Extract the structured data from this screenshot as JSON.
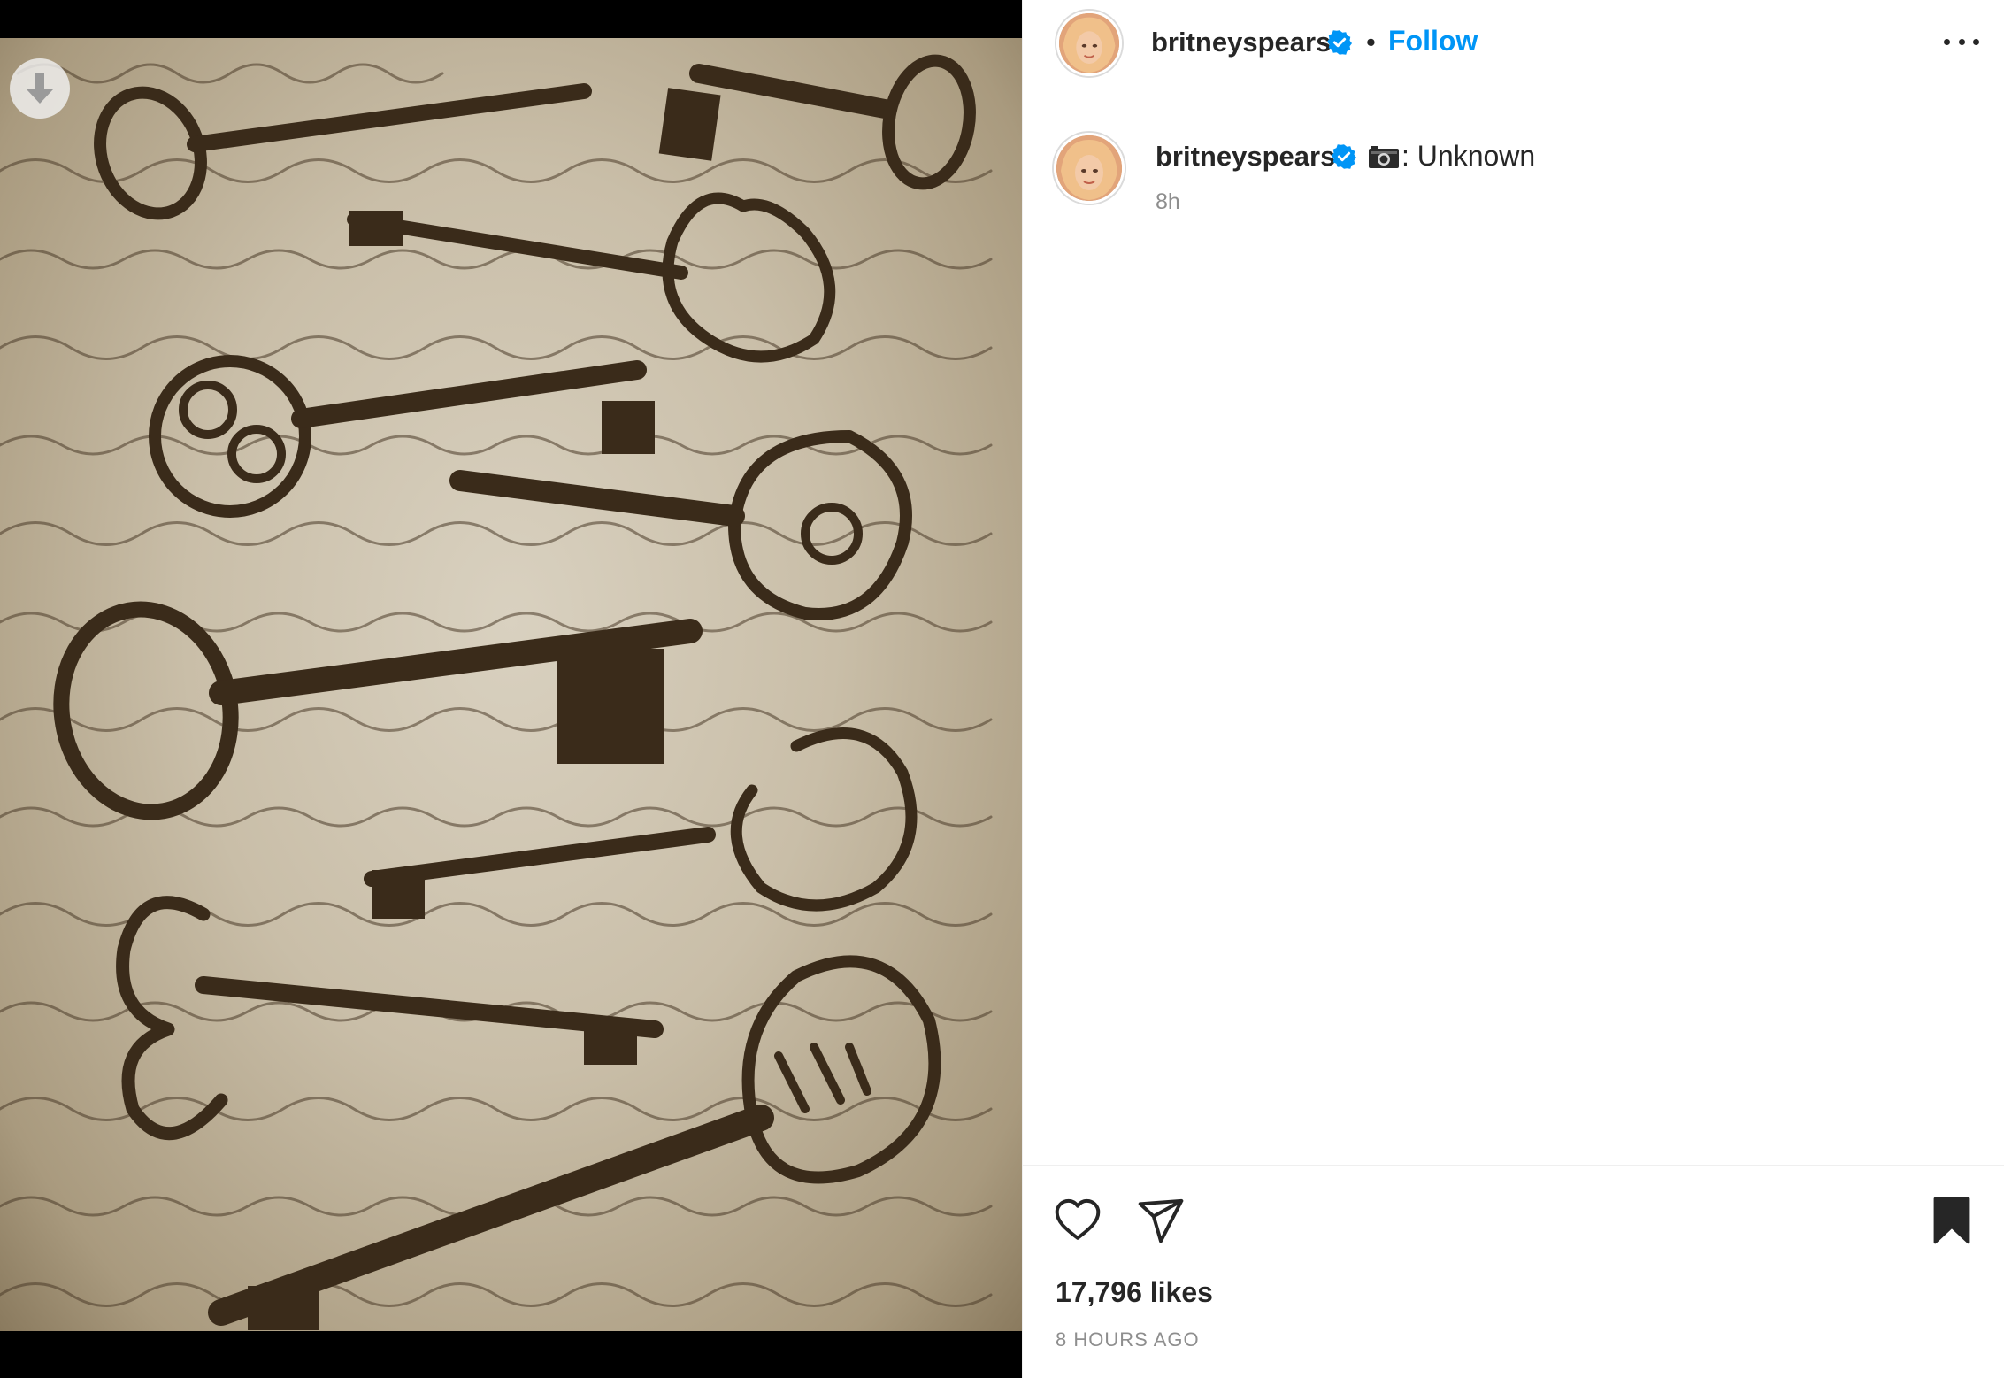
{
  "post": {
    "author": {
      "username": "britneyspears",
      "verified": true,
      "follow_label": "Follow",
      "separator": "•"
    },
    "caption": {
      "username": "britneyspears",
      "text": ": Unknown",
      "leading_icon": "camera-icon",
      "relative_time": "8h"
    },
    "likes_text": "17,796 likes",
    "posted_ago": "8 HOURS AGO",
    "media": {
      "description_icon": "photo",
      "download_icon": "arrow-down-icon"
    },
    "colors": {
      "link_blue": "#0095f6",
      "verified_blue": "#0095f6",
      "text_primary": "#262626",
      "text_secondary": "#8e8e8e"
    }
  }
}
